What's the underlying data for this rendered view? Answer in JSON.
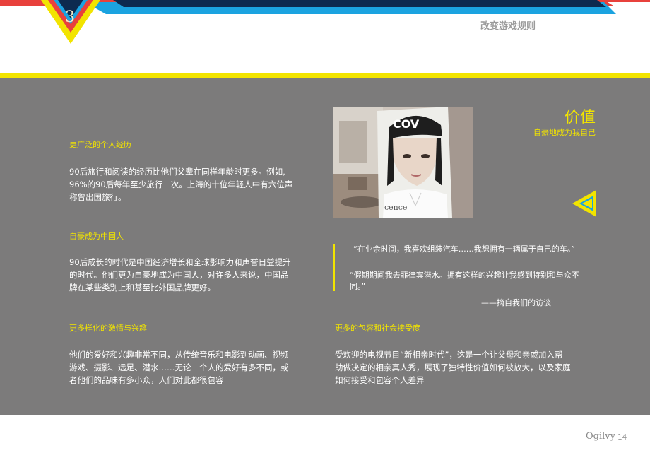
{
  "header": {
    "chapter_number": "3",
    "section_title": "改变游戏规则"
  },
  "left_column": {
    "sections": [
      {
        "heading": "更广泛的个人经历",
        "lines": [
          "90后旅行和阅读的经历比他们父辈在同样年龄时更多。例如,",
          "96%的90后每年至少旅行一次。上海的十位年轻人中有六位声",
          "称曾出国旅行。"
        ]
      },
      {
        "heading": "自豪成为中国人",
        "lines": [
          "90后成长的时代是中国经济增长和全球影响力和声誉日益提升",
          "的时代。他们更为自豪地成为中国人，对许多人来说，中国品",
          "牌在某些类别上和甚至比外国品牌更好。"
        ]
      },
      {
        "heading": "更多样化的激情与兴趣",
        "lines": [
          "他们的爱好和兴趣非常不同，从传统音乐和电影到动画、视频",
          "游戏、摄影、远足、潜水……无论一个人的爱好有多不同，或",
          "者他们的品味有多小众，人们对此都很包容"
        ]
      }
    ]
  },
  "right_column": {
    "value_title": "价值",
    "value_subtitle": "自豪地成为我自己",
    "photo": {
      "cap_text": "COV",
      "shirt_text": "cence"
    },
    "quotes": [
      {
        "lines": [
          "“在业余时间，我喜欢组装汽车……我想拥有一辆属于自己的车。”"
        ]
      },
      {
        "lines": [
          "“假期期间我去菲律宾潜水。拥有这样的兴趣让我感到特别和与众不",
          "同。”"
        ]
      }
    ],
    "quote_source": "——摘自我们的访谈",
    "section": {
      "heading": "更多的包容和社会接受度",
      "lines": [
        "受欢迎的电视节目“新相亲时代”，这是一个让父母和亲戚加入帮",
        "助做决定的相亲真人秀，展现了独特性价值如何被放大，以及家庭",
        "如何接受和包容个人差异"
      ]
    }
  },
  "footer": {
    "logo": "Ogilvy",
    "page_number": "14"
  },
  "colors": {
    "accent_yellow": "#f2e400",
    "stripe_red": "#e8413c",
    "stripe_blue": "#1ba3e0",
    "stripe_navy": "#0d2a4f",
    "panel_gray": "#7c7b7b"
  }
}
